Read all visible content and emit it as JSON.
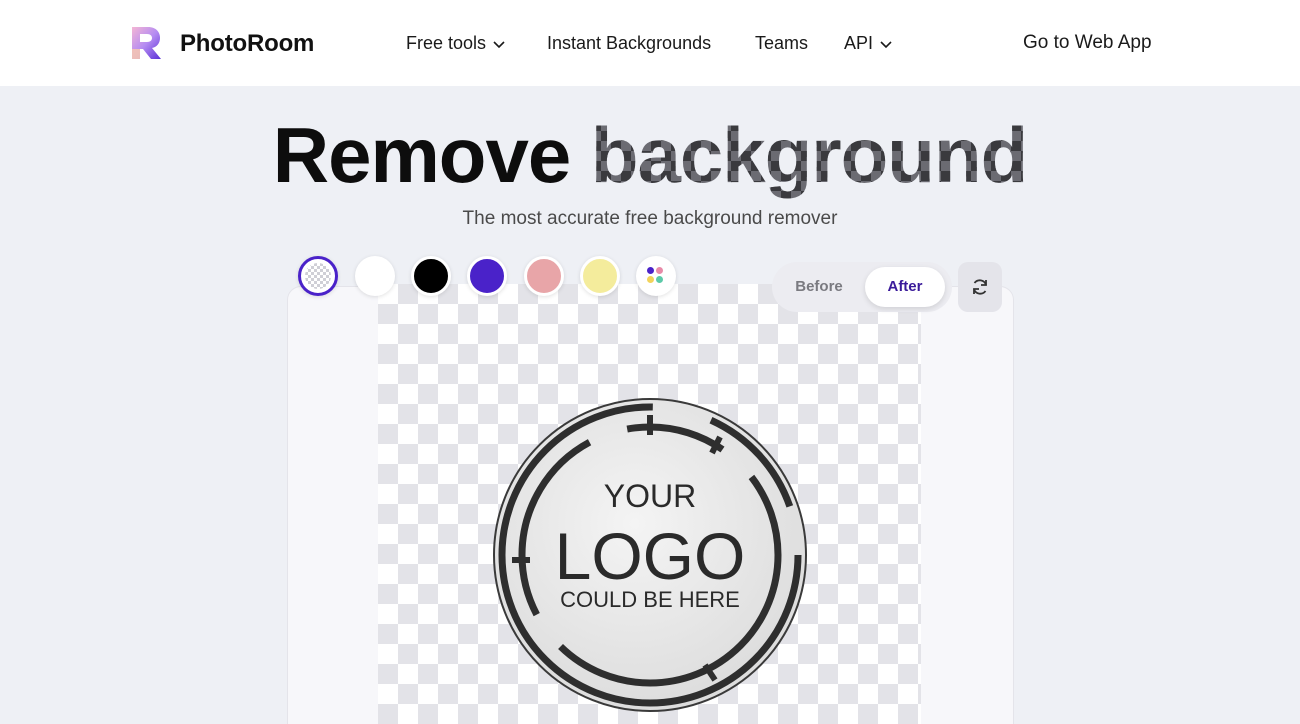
{
  "nav": {
    "brand": "PhotoRoom",
    "items": [
      {
        "label": "Free tools",
        "has_dropdown": true
      },
      {
        "label": "Instant Backgrounds",
        "has_dropdown": false
      },
      {
        "label": "Teams",
        "has_dropdown": false
      },
      {
        "label": "API",
        "has_dropdown": true
      }
    ],
    "cta": "Go to Web App"
  },
  "hero": {
    "headline_word1": "Remove",
    "headline_word2": "background",
    "subtitle": "The most accurate free background remover"
  },
  "swatches": [
    {
      "name": "transparent",
      "color": "transparent",
      "selected": true
    },
    {
      "name": "white",
      "color": "#ffffff",
      "selected": false
    },
    {
      "name": "black",
      "color": "#000000",
      "selected": false
    },
    {
      "name": "purple",
      "color": "#4a22c9",
      "selected": false
    },
    {
      "name": "pink",
      "color": "#e8a5a8",
      "selected": false
    },
    {
      "name": "yellow",
      "color": "#f4ec9c",
      "selected": false
    },
    {
      "name": "more-colors",
      "color": "multi",
      "selected": false
    }
  ],
  "toggle": {
    "before_label": "Before",
    "after_label": "After",
    "active": "After"
  },
  "image": {
    "line1": "YOUR",
    "line2": "LOGO",
    "line3": "COULD BE HERE"
  },
  "colors": {
    "accent": "#4a22c9",
    "background": "#eef0f5"
  }
}
